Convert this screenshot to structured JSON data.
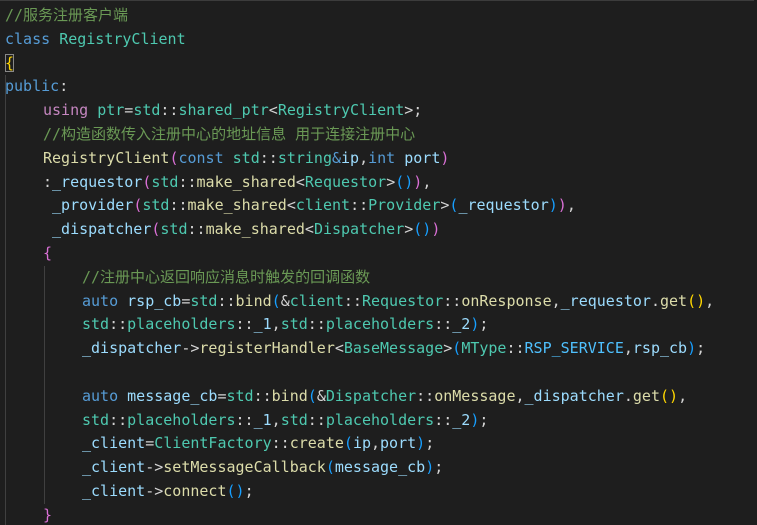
{
  "editor": {
    "colors": {
      "background": "#1e1e1e",
      "comment": "#6a9955",
      "keyword": "#569cd6",
      "type": "#4ec9b0",
      "function": "#dcdcaa",
      "variable": "#9cdcfe",
      "plain": "#d4d4d4",
      "bracket_1": "#ffd700",
      "bracket_2": "#da70d6",
      "bracket_3": "#179fff",
      "enum_member": "#4fc1ff"
    },
    "lines": [
      {
        "indent": 0,
        "tokens": [
          {
            "t": "//服务注册客户端",
            "k": "comment"
          }
        ]
      },
      {
        "indent": 0,
        "tokens": [
          {
            "t": "class",
            "k": "kw"
          },
          {
            "t": " ",
            "k": "plain"
          },
          {
            "t": "RegistryClient",
            "k": "type"
          }
        ]
      },
      {
        "indent": 0,
        "tokens": [
          {
            "t": "{",
            "k": "p1",
            "hl": true
          }
        ]
      },
      {
        "indent": 0,
        "tokens": [
          {
            "t": "public",
            "k": "kw"
          },
          {
            "t": ":",
            "k": "plain"
          }
        ]
      },
      {
        "indent": 1,
        "tokens": [
          {
            "t": "using",
            "k": "ctrl"
          },
          {
            "t": " ",
            "k": "plain"
          },
          {
            "t": "ptr",
            "k": "type"
          },
          {
            "t": "=",
            "k": "op"
          },
          {
            "t": "std",
            "k": "type"
          },
          {
            "t": "::",
            "k": "plain"
          },
          {
            "t": "shared_ptr",
            "k": "type"
          },
          {
            "t": "<",
            "k": "plain"
          },
          {
            "t": "RegistryClient",
            "k": "type"
          },
          {
            "t": ">;",
            "k": "plain"
          }
        ]
      },
      {
        "indent": 1,
        "tokens": [
          {
            "t": "//构造函数传入注册中心的地址信息 用于连接注册中心",
            "k": "comment"
          }
        ]
      },
      {
        "indent": 1,
        "tokens": [
          {
            "t": "RegistryClient",
            "k": "fn"
          },
          {
            "t": "(",
            "k": "p2"
          },
          {
            "t": "const",
            "k": "kw"
          },
          {
            "t": " ",
            "k": "plain"
          },
          {
            "t": "std",
            "k": "type"
          },
          {
            "t": "::",
            "k": "plain"
          },
          {
            "t": "string",
            "k": "type"
          },
          {
            "t": "&",
            "k": "kw"
          },
          {
            "t": "ip",
            "k": "var"
          },
          {
            "t": ",",
            "k": "plain"
          },
          {
            "t": "int",
            "k": "kw"
          },
          {
            "t": " ",
            "k": "plain"
          },
          {
            "t": "port",
            "k": "var"
          },
          {
            "t": ")",
            "k": "p2"
          }
        ]
      },
      {
        "indent": 1,
        "tokens": [
          {
            "t": ":",
            "k": "plain"
          },
          {
            "t": "_requestor",
            "k": "var"
          },
          {
            "t": "(",
            "k": "p2"
          },
          {
            "t": "std",
            "k": "type"
          },
          {
            "t": "::",
            "k": "plain"
          },
          {
            "t": "make_shared",
            "k": "fn"
          },
          {
            "t": "<",
            "k": "plain"
          },
          {
            "t": "Requestor",
            "k": "type"
          },
          {
            "t": ">",
            "k": "plain"
          },
          {
            "t": "()",
            "k": "p3"
          },
          {
            "t": ")",
            "k": "p2"
          },
          {
            "t": ",",
            "k": "plain"
          }
        ]
      },
      {
        "indent": 1,
        "tokens": [
          {
            "t": " ",
            "k": "plain"
          },
          {
            "t": "_provider",
            "k": "var"
          },
          {
            "t": "(",
            "k": "p2"
          },
          {
            "t": "std",
            "k": "type"
          },
          {
            "t": "::",
            "k": "plain"
          },
          {
            "t": "make_shared",
            "k": "fn"
          },
          {
            "t": "<",
            "k": "plain"
          },
          {
            "t": "client",
            "k": "type"
          },
          {
            "t": "::",
            "k": "plain"
          },
          {
            "t": "Provider",
            "k": "type"
          },
          {
            "t": ">",
            "k": "plain"
          },
          {
            "t": "(",
            "k": "p3"
          },
          {
            "t": "_requestor",
            "k": "var"
          },
          {
            "t": ")",
            "k": "p3"
          },
          {
            "t": ")",
            "k": "p2"
          },
          {
            "t": ",",
            "k": "plain"
          }
        ]
      },
      {
        "indent": 1,
        "tokens": [
          {
            "t": " ",
            "k": "plain"
          },
          {
            "t": "_dispatcher",
            "k": "var"
          },
          {
            "t": "(",
            "k": "p2"
          },
          {
            "t": "std",
            "k": "type"
          },
          {
            "t": "::",
            "k": "plain"
          },
          {
            "t": "make_shared",
            "k": "fn"
          },
          {
            "t": "<",
            "k": "plain"
          },
          {
            "t": "Dispatcher",
            "k": "type"
          },
          {
            "t": ">",
            "k": "plain"
          },
          {
            "t": "()",
            "k": "p3"
          },
          {
            "t": ")",
            "k": "p2"
          }
        ]
      },
      {
        "indent": 1,
        "tokens": [
          {
            "t": "{",
            "k": "p2"
          }
        ]
      },
      {
        "indent": 2,
        "tokens": [
          {
            "t": "//注册中心返回响应消息时触发的回调函数",
            "k": "comment"
          }
        ]
      },
      {
        "indent": 2,
        "tokens": [
          {
            "t": "auto",
            "k": "kw"
          },
          {
            "t": " ",
            "k": "plain"
          },
          {
            "t": "rsp_cb",
            "k": "var"
          },
          {
            "t": "=",
            "k": "op"
          },
          {
            "t": "std",
            "k": "type"
          },
          {
            "t": "::",
            "k": "plain"
          },
          {
            "t": "bind",
            "k": "fn"
          },
          {
            "t": "(",
            "k": "p3"
          },
          {
            "t": "&",
            "k": "op"
          },
          {
            "t": "client",
            "k": "type"
          },
          {
            "t": "::",
            "k": "plain"
          },
          {
            "t": "Requestor",
            "k": "type"
          },
          {
            "t": "::",
            "k": "plain"
          },
          {
            "t": "onResponse",
            "k": "fn"
          },
          {
            "t": ",",
            "k": "plain"
          },
          {
            "t": "_requestor",
            "k": "var"
          },
          {
            "t": ".",
            "k": "plain"
          },
          {
            "t": "get",
            "k": "fn"
          },
          {
            "t": "()",
            "k": "p1"
          },
          {
            "t": ",",
            "k": "plain"
          }
        ]
      },
      {
        "indent": 2,
        "tokens": [
          {
            "t": "std",
            "k": "type"
          },
          {
            "t": "::",
            "k": "plain"
          },
          {
            "t": "placeholders",
            "k": "type"
          },
          {
            "t": "::",
            "k": "plain"
          },
          {
            "t": "_1",
            "k": "var"
          },
          {
            "t": ",",
            "k": "plain"
          },
          {
            "t": "std",
            "k": "type"
          },
          {
            "t": "::",
            "k": "plain"
          },
          {
            "t": "placeholders",
            "k": "type"
          },
          {
            "t": "::",
            "k": "plain"
          },
          {
            "t": "_2",
            "k": "var"
          },
          {
            "t": ")",
            "k": "p3"
          },
          {
            "t": ";",
            "k": "plain"
          }
        ]
      },
      {
        "indent": 2,
        "tokens": [
          {
            "t": "_dispatcher",
            "k": "var"
          },
          {
            "t": "->",
            "k": "plain"
          },
          {
            "t": "registerHandler",
            "k": "fn"
          },
          {
            "t": "<",
            "k": "plain"
          },
          {
            "t": "BaseMessage",
            "k": "type"
          },
          {
            "t": ">",
            "k": "plain"
          },
          {
            "t": "(",
            "k": "p3"
          },
          {
            "t": "MType",
            "k": "type"
          },
          {
            "t": "::",
            "k": "plain"
          },
          {
            "t": "RSP_SERVICE",
            "k": "enum"
          },
          {
            "t": ",",
            "k": "plain"
          },
          {
            "t": "rsp_cb",
            "k": "var"
          },
          {
            "t": ")",
            "k": "p3"
          },
          {
            "t": ";",
            "k": "plain"
          }
        ]
      },
      {
        "indent": 2,
        "tokens": []
      },
      {
        "indent": 2,
        "tokens": [
          {
            "t": "auto",
            "k": "kw"
          },
          {
            "t": " ",
            "k": "plain"
          },
          {
            "t": "message_cb",
            "k": "var"
          },
          {
            "t": "=",
            "k": "op"
          },
          {
            "t": "std",
            "k": "type"
          },
          {
            "t": "::",
            "k": "plain"
          },
          {
            "t": "bind",
            "k": "fn"
          },
          {
            "t": "(",
            "k": "p3"
          },
          {
            "t": "&",
            "k": "op"
          },
          {
            "t": "Dispatcher",
            "k": "type"
          },
          {
            "t": "::",
            "k": "plain"
          },
          {
            "t": "onMessage",
            "k": "fn"
          },
          {
            "t": ",",
            "k": "plain"
          },
          {
            "t": "_dispatcher",
            "k": "var"
          },
          {
            "t": ".",
            "k": "plain"
          },
          {
            "t": "get",
            "k": "fn"
          },
          {
            "t": "()",
            "k": "p1"
          },
          {
            "t": ",",
            "k": "plain"
          }
        ]
      },
      {
        "indent": 2,
        "tokens": [
          {
            "t": "std",
            "k": "type"
          },
          {
            "t": "::",
            "k": "plain"
          },
          {
            "t": "placeholders",
            "k": "type"
          },
          {
            "t": "::",
            "k": "plain"
          },
          {
            "t": "_1",
            "k": "var"
          },
          {
            "t": ",",
            "k": "plain"
          },
          {
            "t": "std",
            "k": "type"
          },
          {
            "t": "::",
            "k": "plain"
          },
          {
            "t": "placeholders",
            "k": "type"
          },
          {
            "t": "::",
            "k": "plain"
          },
          {
            "t": "_2",
            "k": "var"
          },
          {
            "t": ")",
            "k": "p3"
          },
          {
            "t": ";",
            "k": "plain"
          }
        ]
      },
      {
        "indent": 2,
        "tokens": [
          {
            "t": "_client",
            "k": "var"
          },
          {
            "t": "=",
            "k": "op"
          },
          {
            "t": "ClientFactory",
            "k": "type"
          },
          {
            "t": "::",
            "k": "plain"
          },
          {
            "t": "create",
            "k": "fn"
          },
          {
            "t": "(",
            "k": "p3"
          },
          {
            "t": "ip",
            "k": "var"
          },
          {
            "t": ",",
            "k": "plain"
          },
          {
            "t": "port",
            "k": "var"
          },
          {
            "t": ")",
            "k": "p3"
          },
          {
            "t": ";",
            "k": "plain"
          }
        ]
      },
      {
        "indent": 2,
        "tokens": [
          {
            "t": "_client",
            "k": "var"
          },
          {
            "t": "->",
            "k": "plain"
          },
          {
            "t": "setMessageCallback",
            "k": "fn"
          },
          {
            "t": "(",
            "k": "p3"
          },
          {
            "t": "message_cb",
            "k": "var"
          },
          {
            "t": ")",
            "k": "p3"
          },
          {
            "t": ";",
            "k": "plain"
          }
        ]
      },
      {
        "indent": 2,
        "tokens": [
          {
            "t": "_client",
            "k": "var"
          },
          {
            "t": "->",
            "k": "plain"
          },
          {
            "t": "connect",
            "k": "fn"
          },
          {
            "t": "()",
            "k": "p3"
          },
          {
            "t": ";",
            "k": "plain"
          }
        ]
      },
      {
        "indent": 1,
        "tokens": [
          {
            "t": "}",
            "k": "p2"
          }
        ]
      }
    ]
  }
}
